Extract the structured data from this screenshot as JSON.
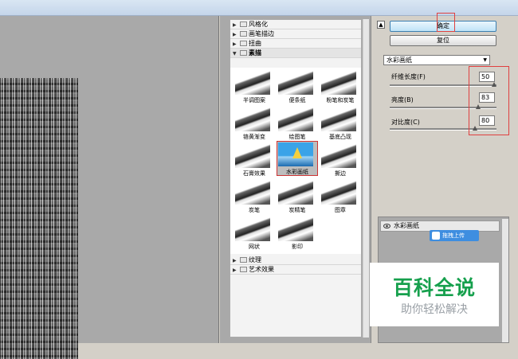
{
  "tree": {
    "categories": [
      {
        "label": "风格化",
        "expanded": false
      },
      {
        "label": "画笔描边",
        "expanded": false
      },
      {
        "label": "扭曲",
        "expanded": false
      },
      {
        "label": "素描",
        "expanded": true
      }
    ],
    "sketch_filters": [
      "半调图案",
      "便条纸",
      "粉笔和炭笔",
      "铬黄渐变",
      "绘图笔",
      "基底凸现",
      "石膏效果",
      "水彩画纸",
      "撕边",
      "炭笔",
      "炭精笔",
      "图章",
      "网状",
      "影印"
    ],
    "selected_filter": "水彩画纸",
    "more_categories": [
      {
        "label": "纹理",
        "expanded": false
      },
      {
        "label": "艺术效果",
        "expanded": false
      }
    ]
  },
  "settings": {
    "ok_label": "确定",
    "reset_label": "复位",
    "filter_select": "水彩画纸",
    "params": [
      {
        "label": "纤维长度(F)",
        "value": "50",
        "level": 0.98
      },
      {
        "label": "亮度(B)",
        "value": "83",
        "level": 0.83
      },
      {
        "label": "对比度(C)",
        "value": "80",
        "level": 0.8
      }
    ]
  },
  "layers": {
    "layer_name": "水彩画纸",
    "upload_label": "拖拽上传"
  },
  "watermark": {
    "title": "百科全说",
    "subtitle": "助你轻松解决"
  },
  "colors": {
    "accent_red": "#e04040",
    "upload_blue": "#3e8ee0",
    "watermark_green": "#16a04d"
  }
}
